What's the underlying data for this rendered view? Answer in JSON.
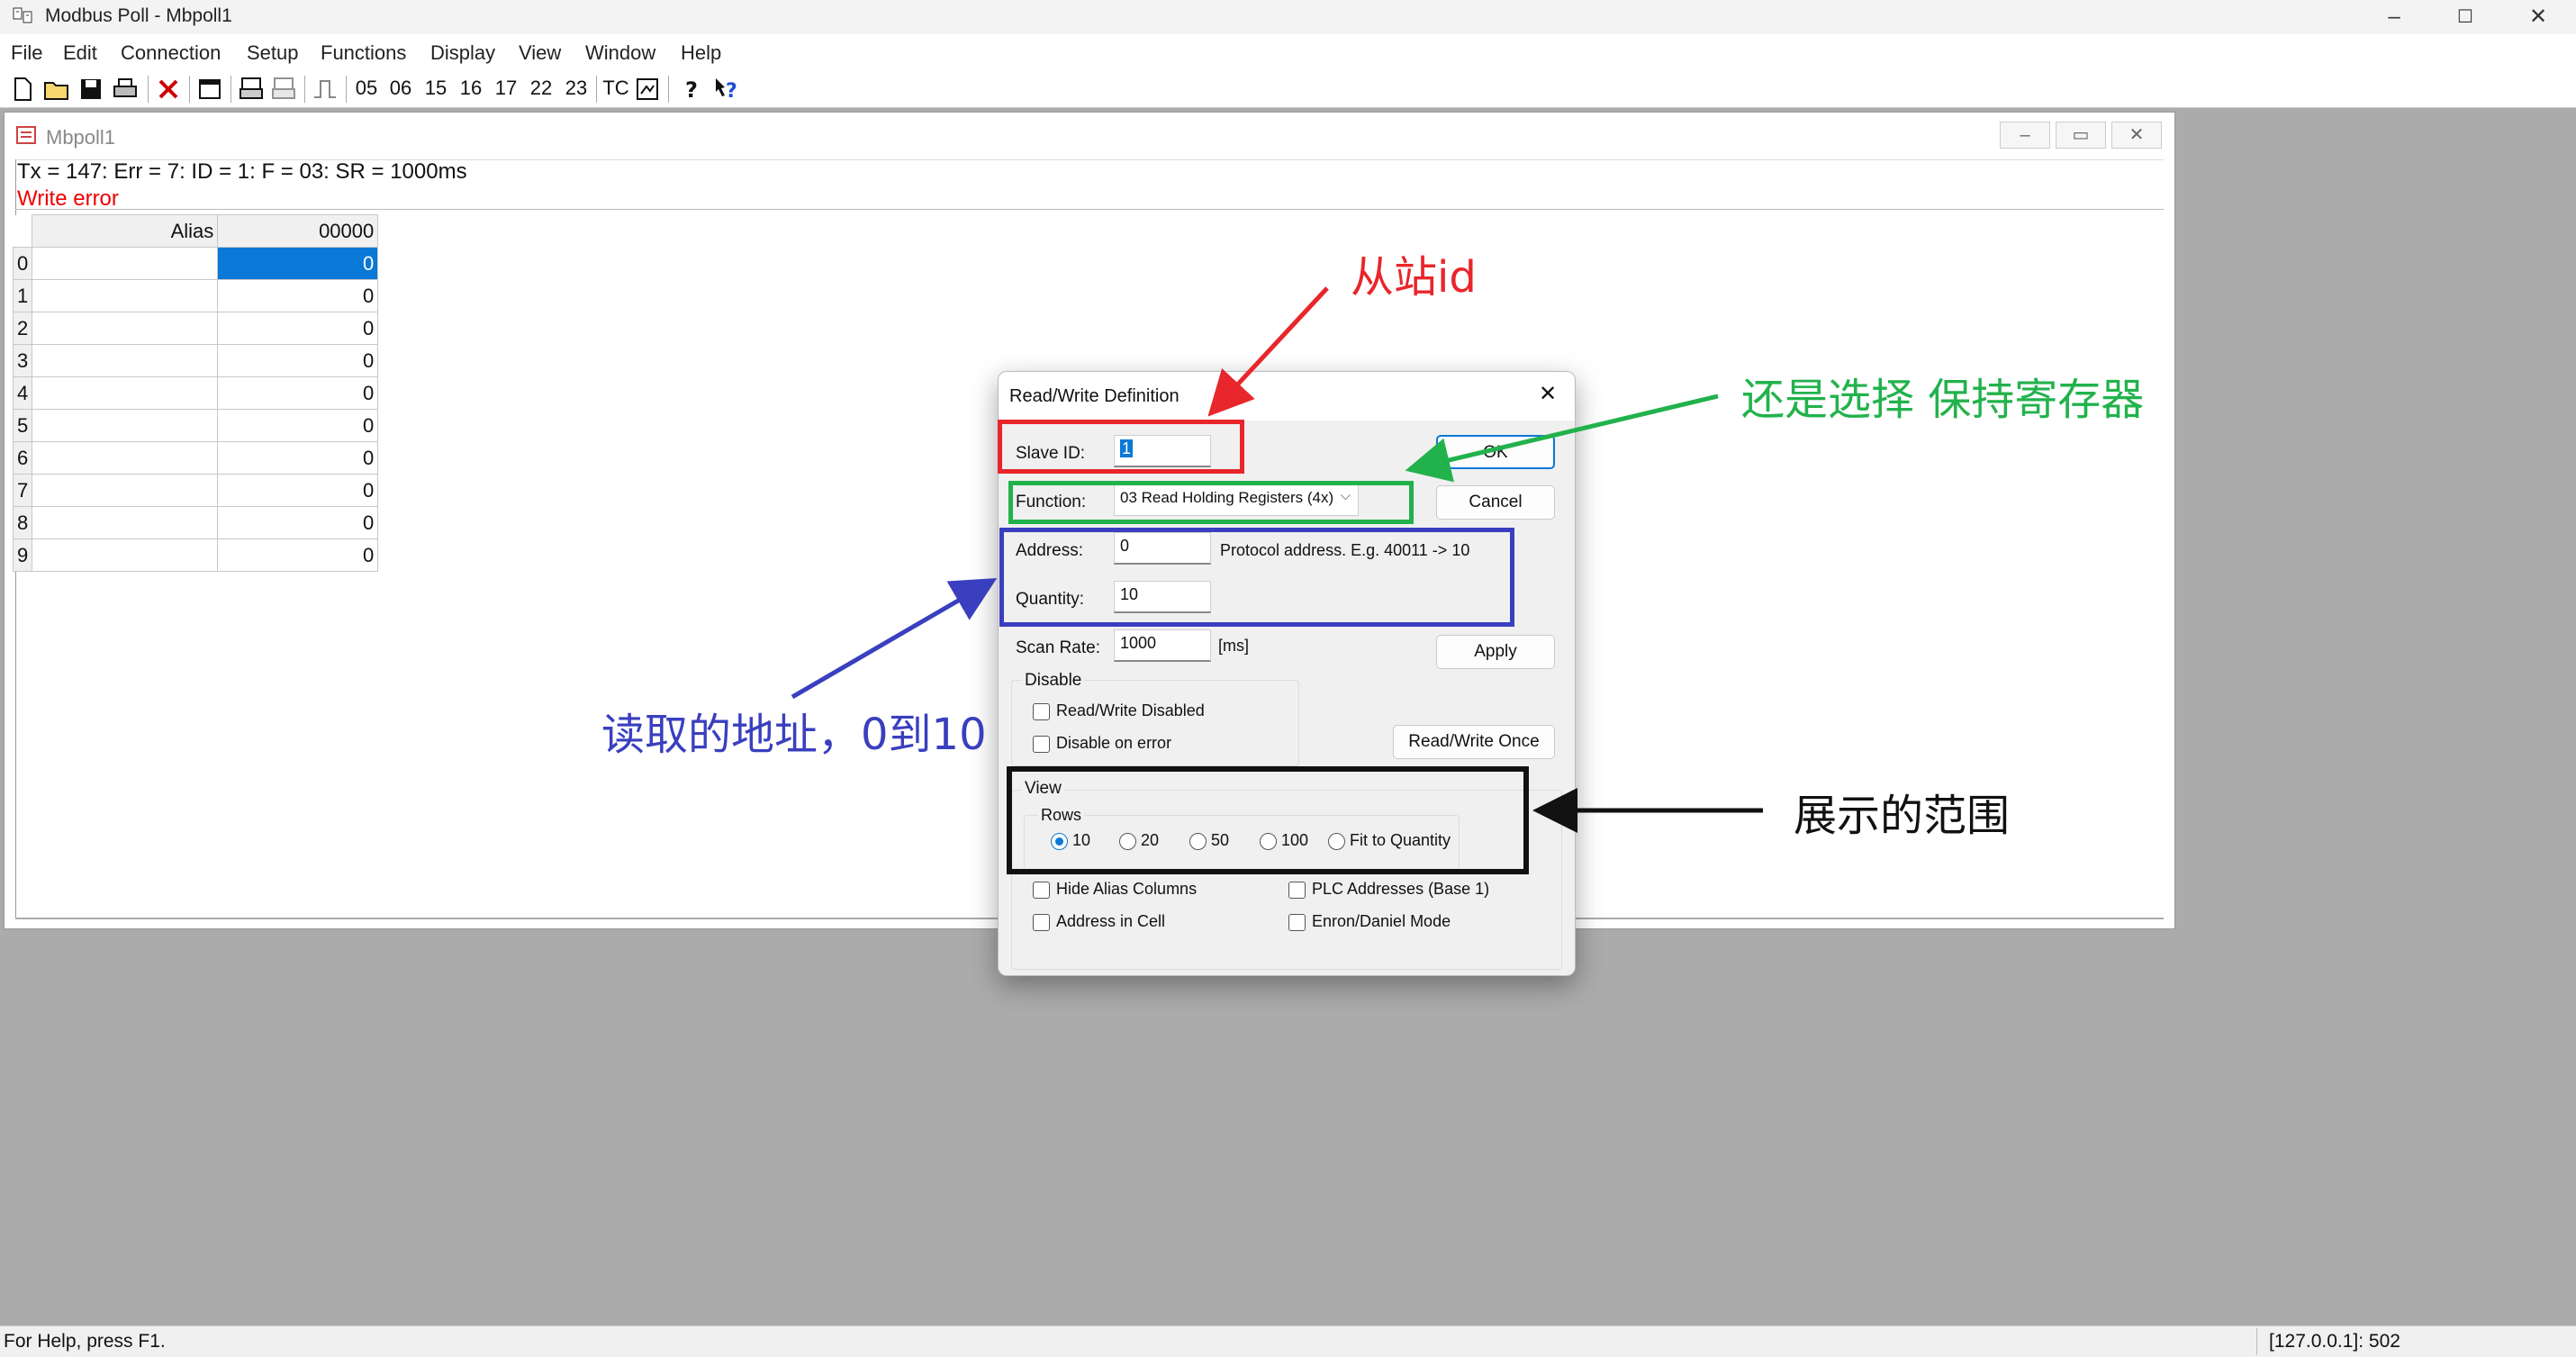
{
  "window": {
    "title": "Modbus Poll - Mbpoll1"
  },
  "menu": [
    "File",
    "Edit",
    "Connection",
    "Setup",
    "Functions",
    "Display",
    "View",
    "Window",
    "Help"
  ],
  "toolbar": {
    "fc": [
      "05",
      "06",
      "15",
      "16",
      "17",
      "22",
      "23"
    ],
    "tc": "TC"
  },
  "child": {
    "title": "Mbpoll1",
    "status_line": "Tx = 147: Err = 7: ID = 1: F = 03: SR = 1000ms",
    "error_line": "Write error",
    "col_alias": "Alias",
    "col_addr": "00000",
    "rows": [
      {
        "idx": "0",
        "val": "0"
      },
      {
        "idx": "1",
        "val": "0"
      },
      {
        "idx": "2",
        "val": "0"
      },
      {
        "idx": "3",
        "val": "0"
      },
      {
        "idx": "4",
        "val": "0"
      },
      {
        "idx": "5",
        "val": "0"
      },
      {
        "idx": "6",
        "val": "0"
      },
      {
        "idx": "7",
        "val": "0"
      },
      {
        "idx": "8",
        "val": "0"
      },
      {
        "idx": "9",
        "val": "0"
      }
    ]
  },
  "dialog": {
    "title": "Read/Write Definition",
    "slave_id_label": "Slave ID:",
    "slave_id": "1",
    "function_label": "Function:",
    "function_value": "03 Read Holding Registers (4x)",
    "address_label": "Address:",
    "address": "0",
    "address_hint": "Protocol address. E.g. 40011 -> 10",
    "quantity_label": "Quantity:",
    "quantity": "10",
    "scan_rate_label": "Scan Rate:",
    "scan_rate": "1000",
    "scan_unit": "[ms]",
    "ok": "OK",
    "cancel": "Cancel",
    "apply": "Apply",
    "rw_once": "Read/Write Once",
    "disable_group": "Disable",
    "rw_disabled": "Read/Write Disabled",
    "disable_on_error": "Disable on error",
    "view_group": "View",
    "rows_group": "Rows",
    "rows_options": [
      "10",
      "20",
      "50",
      "100",
      "Fit to Quantity"
    ],
    "rows_selected": "10",
    "hide_alias": "Hide Alias Columns",
    "plc_addr": "PLC Addresses (Base 1)",
    "addr_in_cell": "Address in Cell",
    "enron": "Enron/Daniel Mode"
  },
  "annotations": {
    "slave_id": "从站id",
    "function": "还是选择 保持寄存器",
    "address": "读取的地址，0到10",
    "view": "展示的范围",
    "colors": {
      "red": "#e8262b",
      "green": "#22b24c",
      "blue": "#3a3fbf",
      "black": "#111111"
    }
  },
  "statusbar": {
    "help": "For Help, press F1.",
    "conn": "[127.0.0.1]: 502"
  }
}
